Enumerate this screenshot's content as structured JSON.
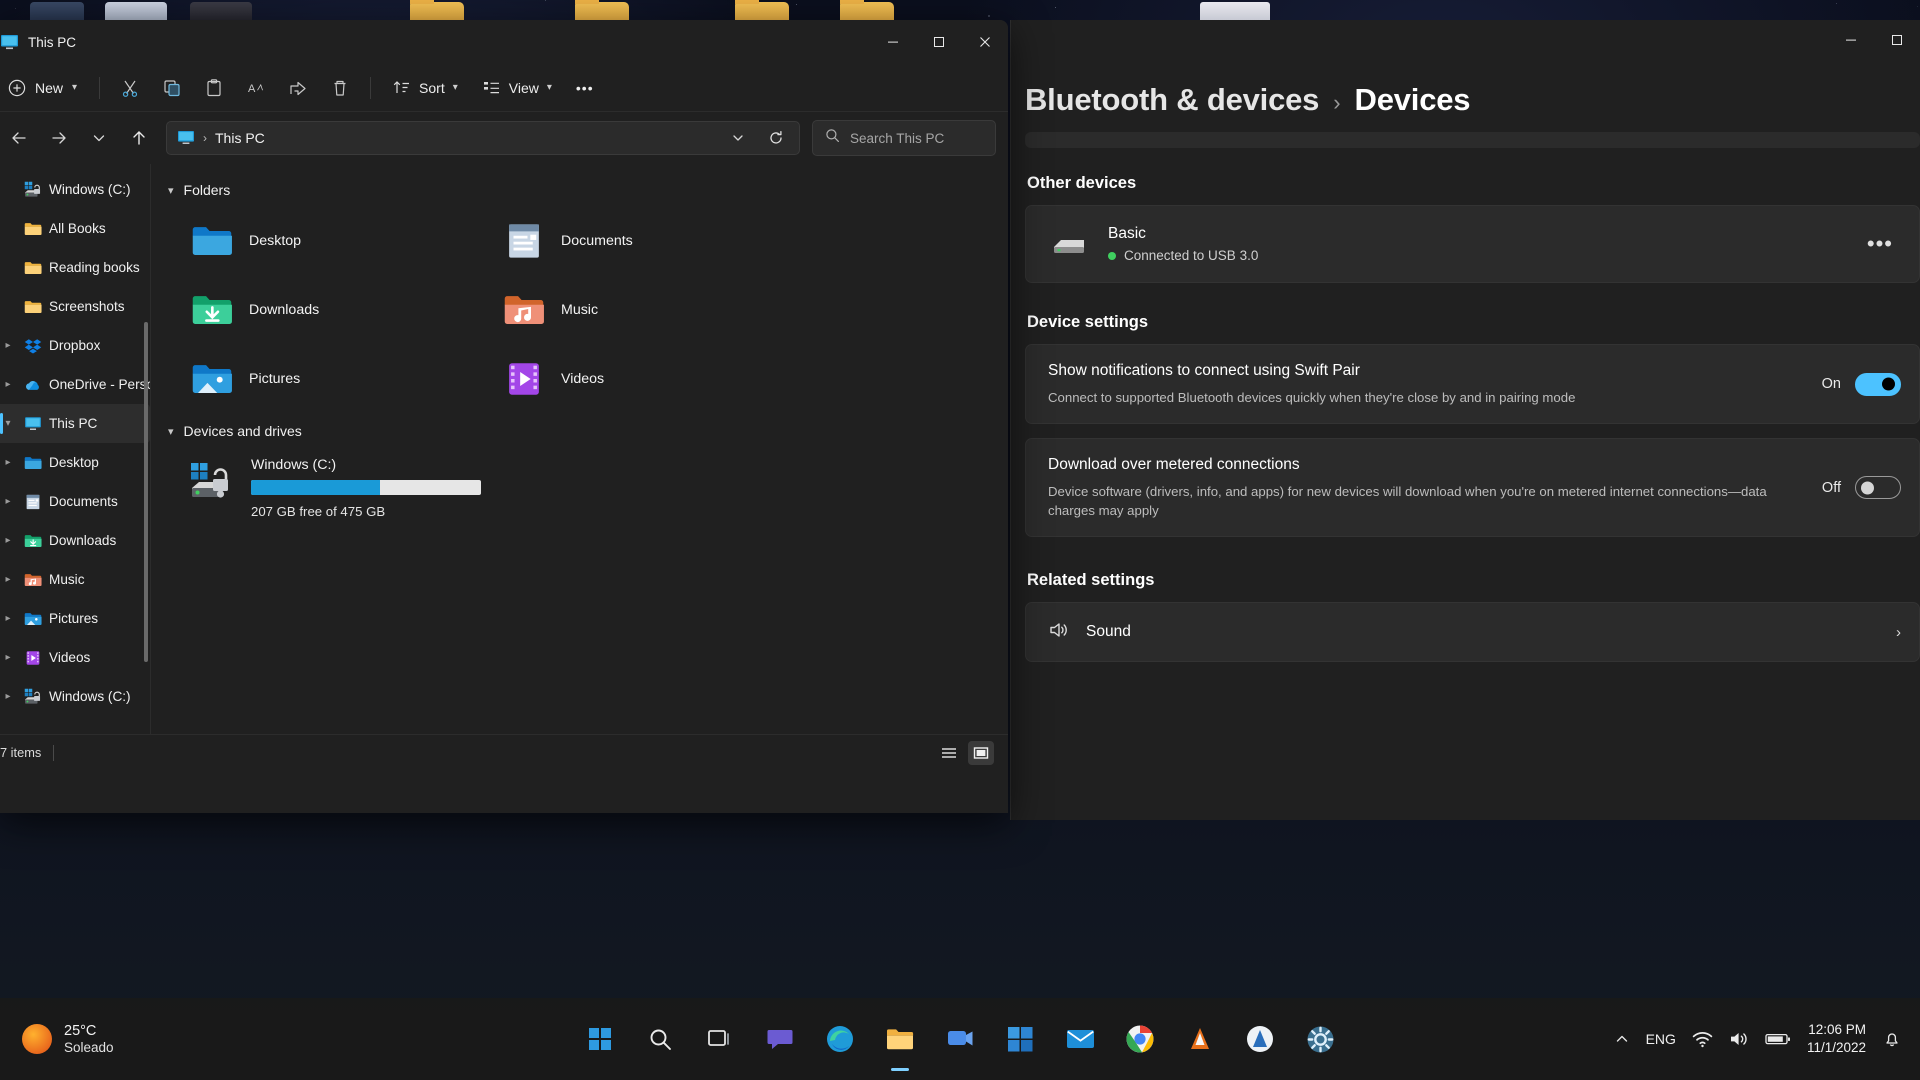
{
  "explorer": {
    "title": "This PC",
    "title_icon": "this-pc-icon",
    "window_controls": {
      "minimize": "minimize-icon",
      "maximize": "maximize-icon",
      "close": "close-icon"
    },
    "toolbar": {
      "new_label": "New",
      "cut": "cut-icon",
      "copy": "copy-icon",
      "paste": "paste-icon",
      "rename": "rename-icon",
      "share": "share-icon",
      "delete": "delete-icon",
      "sort_label": "Sort",
      "view_label": "View",
      "more_label": "•••"
    },
    "nav": {
      "back": "back-arrow-icon",
      "forward": "forward-arrow-icon",
      "recent": "chevron-down-icon",
      "up": "up-arrow-icon",
      "address_icon": "this-pc-icon",
      "address_separator": "›",
      "address_text": "This PC",
      "address_dropdown": "chevron-down-icon",
      "refresh": "refresh-icon"
    },
    "search": {
      "placeholder": "Search This PC",
      "icon": "search-icon"
    },
    "sidebar": [
      {
        "label": "Windows (C:)",
        "icon": "windows-drive-icon",
        "expandable": false,
        "selected": false
      },
      {
        "label": "All Books",
        "icon": "folder-icon",
        "expandable": false,
        "selected": false
      },
      {
        "label": "Reading books",
        "icon": "folder-icon",
        "expandable": false,
        "selected": false
      },
      {
        "label": "Screenshots",
        "icon": "folder-icon",
        "expandable": false,
        "selected": false
      },
      {
        "label": "Dropbox",
        "icon": "dropbox-icon",
        "expandable": true,
        "selected": false
      },
      {
        "label": "OneDrive - Perso",
        "icon": "onedrive-icon",
        "expandable": true,
        "selected": false
      },
      {
        "label": "This PC",
        "icon": "this-pc-icon",
        "expandable": true,
        "selected": true
      },
      {
        "label": "Desktop",
        "icon": "desktop-folder-icon",
        "expandable": true,
        "selected": false
      },
      {
        "label": "Documents",
        "icon": "documents-folder-icon",
        "expandable": true,
        "selected": false
      },
      {
        "label": "Downloads",
        "icon": "downloads-folder-icon",
        "expandable": true,
        "selected": false
      },
      {
        "label": "Music",
        "icon": "music-folder-icon",
        "expandable": true,
        "selected": false
      },
      {
        "label": "Pictures",
        "icon": "pictures-folder-icon",
        "expandable": true,
        "selected": false
      },
      {
        "label": "Videos",
        "icon": "videos-folder-icon",
        "expandable": true,
        "selected": false
      },
      {
        "label": "Windows (C:)",
        "icon": "windows-drive-icon",
        "expandable": true,
        "selected": false
      }
    ],
    "groups": {
      "folders_label": "Folders",
      "folders": [
        {
          "name": "Desktop",
          "icon": "desktop-folder-icon"
        },
        {
          "name": "Documents",
          "icon": "documents-folder-icon"
        },
        {
          "name": "Downloads",
          "icon": "downloads-folder-icon"
        },
        {
          "name": "Music",
          "icon": "music-folder-icon"
        },
        {
          "name": "Pictures",
          "icon": "pictures-folder-icon"
        },
        {
          "name": "Videos",
          "icon": "videos-folder-icon"
        }
      ],
      "drives_label": "Devices and drives",
      "drives": [
        {
          "name": "Windows (C:)",
          "icon": "windows-drive-icon",
          "free_text": "207 GB free of 475 GB",
          "used_percent": 56,
          "bar_color": "#1a9ad7"
        }
      ]
    },
    "status": {
      "item_count": "7 items",
      "layout_list": "list-view-icon",
      "layout_details": "details-view-icon"
    }
  },
  "settings": {
    "window_controls": {
      "minimize": "minimize-icon",
      "maximize": "maximize-icon"
    },
    "breadcrumb_parent": "Bluetooth & devices",
    "breadcrumb_separator": "›",
    "breadcrumb_current": "Devices",
    "other_devices_label": "Other devices",
    "devices": [
      {
        "name": "Basic",
        "status": "Connected to USB 3.0",
        "status_color": "#3fcf5f",
        "icon": "device-hardware-icon",
        "more": "•••"
      }
    ],
    "device_settings_label": "Device settings",
    "options": [
      {
        "title": "Show notifications to connect using Swift Pair",
        "description": "Connect to supported Bluetooth devices quickly when they're close by and in pairing mode",
        "state": "On",
        "toggle_on": true
      },
      {
        "title": "Download over metered connections",
        "description": "Device software (drivers, info, and apps) for new devices will download when you're on metered internet connections—data charges may apply",
        "state": "Off",
        "toggle_on": false
      }
    ],
    "related_settings_label": "Related settings",
    "related": [
      {
        "name": "Sound",
        "icon": "sound-icon",
        "chevron": "›"
      }
    ],
    "accent_color": "#4cc2ff"
  },
  "taskbar": {
    "weather": {
      "temperature": "25°C",
      "condition": "Soleado",
      "icon": "sun-icon"
    },
    "apps": [
      {
        "name": "start-button",
        "icon": "windows-logo-icon",
        "active": false
      },
      {
        "name": "search",
        "icon": "search-icon",
        "active": false
      },
      {
        "name": "task-view",
        "icon": "task-view-icon",
        "active": false
      },
      {
        "name": "chat",
        "icon": "chat-icon",
        "active": false
      },
      {
        "name": "edge",
        "icon": "edge-icon",
        "active": false
      },
      {
        "name": "file-explorer",
        "icon": "file-explorer-icon",
        "active": true
      },
      {
        "name": "teams",
        "icon": "teams-icon",
        "active": false
      },
      {
        "name": "microsoft-store",
        "icon": "store-icon",
        "active": false
      },
      {
        "name": "mail",
        "icon": "mail-icon",
        "active": false
      },
      {
        "name": "chrome",
        "icon": "chrome-icon",
        "active": false
      },
      {
        "name": "vlc",
        "icon": "vlc-icon",
        "active": false
      },
      {
        "name": "app-blue",
        "icon": "app-circle-icon",
        "active": false
      },
      {
        "name": "settings",
        "icon": "settings-gear-icon",
        "active": false
      }
    ],
    "tray": {
      "overflow": "chevron-up-icon",
      "language": "ENG",
      "wifi": "wifi-icon",
      "volume": "volume-icon",
      "battery": "battery-icon",
      "time": "12:06 PM",
      "date": "11/1/2022",
      "notifications": "notification-bell-icon"
    }
  }
}
